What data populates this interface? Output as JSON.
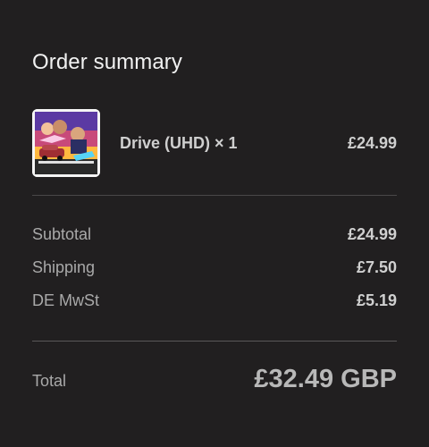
{
  "order_summary": {
    "title": "Order summary",
    "item": {
      "name": "Drive (UHD) × 1",
      "price": "£24.99",
      "thumbnail_icon": "movie-cover-thumbnail"
    },
    "subtotal": {
      "label": "Subtotal",
      "value": "£24.99"
    },
    "shipping": {
      "label": "Shipping",
      "value": "£7.50"
    },
    "tax": {
      "label": "DE MwSt",
      "value": "£5.19"
    },
    "total": {
      "label": "Total",
      "value": "£32.49 GBP"
    }
  },
  "colors": {
    "background": "#211f20",
    "text_primary": "#f1f1f1",
    "text_secondary": "#a9a9a9",
    "divider": "#4a4849"
  }
}
